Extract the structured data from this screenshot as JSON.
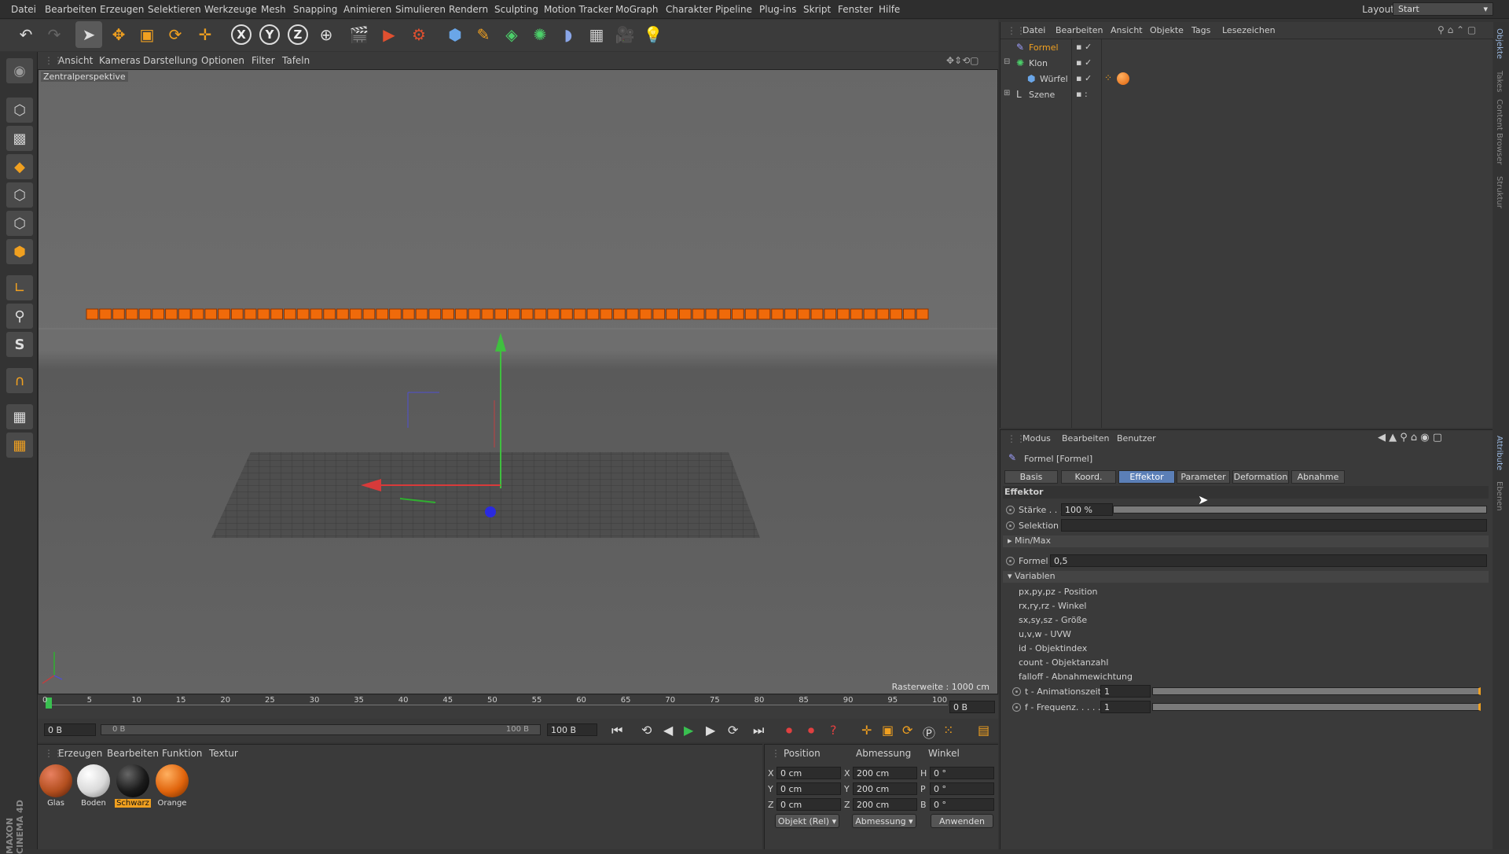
{
  "menubar": {
    "items": [
      "Datei",
      "Bearbeiten",
      "Erzeugen",
      "Selektieren",
      "Werkzeuge",
      "Mesh",
      "Snapping",
      "Animieren",
      "Simulieren",
      "Rendern",
      "Sculpting",
      "Motion Tracker",
      "MoGraph",
      "Charakter",
      "Pipeline",
      "Plug-ins",
      "Skript",
      "Fenster",
      "Hilfe"
    ],
    "layout_label": "Layout:",
    "layout_value": "Start"
  },
  "toolbar": {
    "icons": [
      "undo-icon",
      "redo-icon",
      "select-icon",
      "move-icon",
      "scale-icon",
      "rotate-icon",
      "transform-icon",
      "x-axis-icon",
      "y-axis-icon",
      "z-axis-icon",
      "world-coord-icon",
      "render-view-icon",
      "render-picture-icon",
      "render-settings-icon",
      "cube-icon",
      "pen-icon",
      "subdivision-icon",
      "cloner-icon",
      "deformer-icon",
      "floor-icon",
      "camera-icon",
      "light-icon"
    ],
    "axis_x": "X",
    "axis_y": "Y",
    "axis_z": "Z"
  },
  "viewport": {
    "menu": [
      "Ansicht",
      "Kameras",
      "Darstellung",
      "Optionen",
      "Filter",
      "Tafeln"
    ],
    "camera_label": "Zentralperspektive",
    "grid_label": "Rasterweite : 1000 cm",
    "cube_count": 64
  },
  "timeline": {
    "ticks": [
      "0",
      "5",
      "10",
      "15",
      "20",
      "25",
      "30",
      "35",
      "40",
      "45",
      "50",
      "55",
      "60",
      "65",
      "70",
      "75",
      "80",
      "85",
      "90",
      "95",
      "100"
    ],
    "frame_field": "0 B",
    "start_field": "0 B",
    "range_start": "0 B",
    "range_end": "100 B",
    "end_field": "100 B"
  },
  "materials": {
    "menu": [
      "Erzeugen",
      "Bearbeiten",
      "Funktion",
      "Textur"
    ],
    "items": [
      {
        "name": "Glas",
        "color": "#b34f1f"
      },
      {
        "name": "Boden",
        "color": "#d9d9d9"
      },
      {
        "name": "Schwarz",
        "color": "#1a1a1a"
      },
      {
        "name": "Orange",
        "color": "#e0640c"
      }
    ]
  },
  "coords": {
    "headers": [
      "Position",
      "Abmessung",
      "Winkel"
    ],
    "rows": [
      {
        "axis": "X",
        "pos": "0 cm",
        "size_axis": "X",
        "size": "200 cm",
        "rot_axis": "H",
        "rot": "0 °"
      },
      {
        "axis": "Y",
        "pos": "0 cm",
        "size_axis": "Y",
        "size": "200 cm",
        "rot_axis": "P",
        "rot": "0 °"
      },
      {
        "axis": "Z",
        "pos": "0 cm",
        "size_axis": "Z",
        "size": "200 cm",
        "rot_axis": "B",
        "rot": "0 °"
      }
    ],
    "mode": "Objekt (Rel)",
    "size_mode": "Abmessung",
    "apply": "Anwenden"
  },
  "objects": {
    "menu": [
      "Datei",
      "Bearbeiten",
      "Ansicht",
      "Objekte",
      "Tags",
      "Lesezeichen"
    ],
    "items": [
      {
        "name": "Formel",
        "highlight": true
      },
      {
        "name": "Klon",
        "highlight": false
      },
      {
        "name": "Würfel",
        "highlight": false
      },
      {
        "name": "Szene",
        "highlight": false
      }
    ]
  },
  "attributes": {
    "menu": [
      "Modus",
      "Bearbeiten",
      "Benutzer"
    ],
    "title": "Formel [Formel]",
    "tabs": [
      "Basis",
      "Koord.",
      "Effektor",
      "Parameter",
      "Deformation",
      "Abnahme"
    ],
    "active_tab": "Effektor",
    "section": "Effektor",
    "strength_label": "Stärke . . .",
    "strength_value": "100 %",
    "selection_label": "Selektion",
    "minmax_label": "Min/Max",
    "formula_label": "Formel",
    "formula_value": "0,5",
    "variables_label": "Variablen",
    "variables": [
      "px,py,pz - Position",
      "rx,ry,rz - Winkel",
      "sx,sy,sz - Größe",
      "u,v,w - UVW",
      "id - Objektindex",
      "count - Objektanzahl",
      "falloff - Abnahmewichtung"
    ],
    "t_label": "t - Animationszeit",
    "t_value": "1",
    "f_label": "f - Frequenz. . . . .",
    "f_value": "1"
  },
  "right_tabs": [
    "Objekte",
    "Takes",
    "Content Browser",
    "Struktur",
    "Attribute",
    "Ebenen"
  ],
  "brand": {
    "line1": "MAXON",
    "line2": "CINEMA 4D"
  }
}
